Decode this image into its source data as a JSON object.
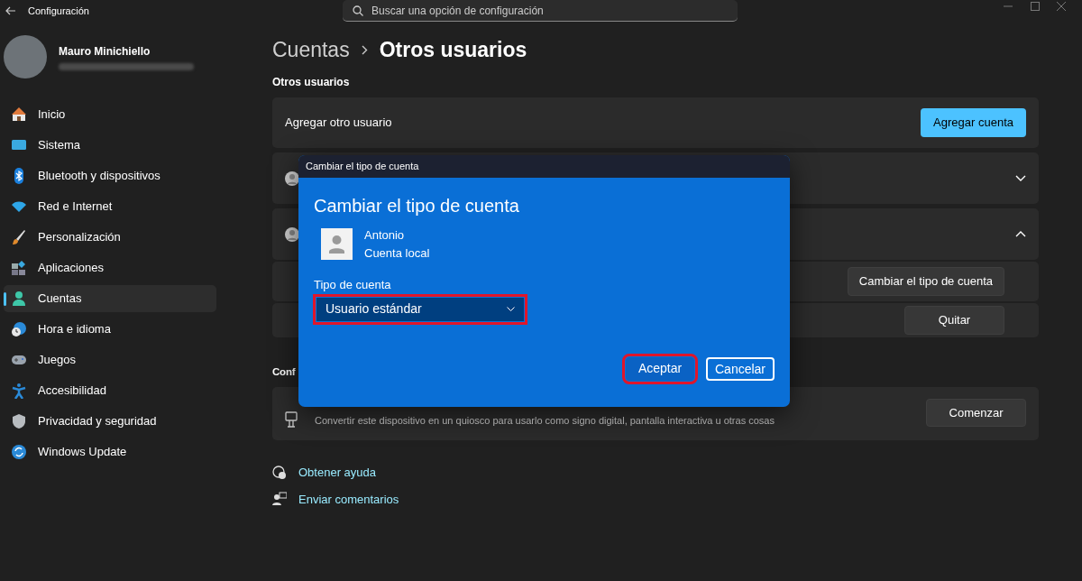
{
  "window": {
    "title": "Configuración"
  },
  "search": {
    "placeholder": "Buscar una opción de configuración"
  },
  "profile": {
    "name": "Mauro Minichiello"
  },
  "sidebar": {
    "items": [
      {
        "label": "Inicio",
        "selected": false
      },
      {
        "label": "Sistema",
        "selected": false
      },
      {
        "label": "Bluetooth y dispositivos",
        "selected": false
      },
      {
        "label": "Red e Internet",
        "selected": false
      },
      {
        "label": "Personalización",
        "selected": false
      },
      {
        "label": "Aplicaciones",
        "selected": false
      },
      {
        "label": "Cuentas",
        "selected": true
      },
      {
        "label": "Hora e idioma",
        "selected": false
      },
      {
        "label": "Juegos",
        "selected": false
      },
      {
        "label": "Accesibilidad",
        "selected": false
      },
      {
        "label": "Privacidad y seguridad",
        "selected": false
      },
      {
        "label": "Windows Update",
        "selected": false
      }
    ]
  },
  "breadcrumb": [
    "Cuentas",
    "Otros usuarios"
  ],
  "other_users": {
    "heading": "Otros usuarios",
    "add_row": {
      "label": "Agregar otro usuario",
      "button": "Agregar cuenta"
    },
    "users": [
      {
        "expanded": false
      },
      {
        "expanded": true,
        "actions": [
          {
            "button": "Cambiar el tipo de cuenta"
          },
          {
            "button": "Quitar"
          }
        ]
      }
    ]
  },
  "kiosk": {
    "heading": "Conf",
    "description": "Convertir este dispositivo en un quiosco para usarlo como signo digital, pantalla interactiva u otras cosas",
    "button": "Comenzar"
  },
  "links": [
    "Obtener ayuda",
    "Enviar comentarios"
  ],
  "dialog": {
    "window_title": "Cambiar el tipo de cuenta",
    "title": "Cambiar el tipo de cuenta",
    "user": {
      "name": "Antonio",
      "account": "Cuenta local"
    },
    "field_label": "Tipo de cuenta",
    "dropdown": {
      "value": "Usuario estándar",
      "highlighted": true
    },
    "buttons": [
      {
        "label": "Aceptar",
        "kind": "primary",
        "highlighted": true
      },
      {
        "label": "Cancelar",
        "kind": "secondary",
        "highlighted": false
      }
    ]
  }
}
